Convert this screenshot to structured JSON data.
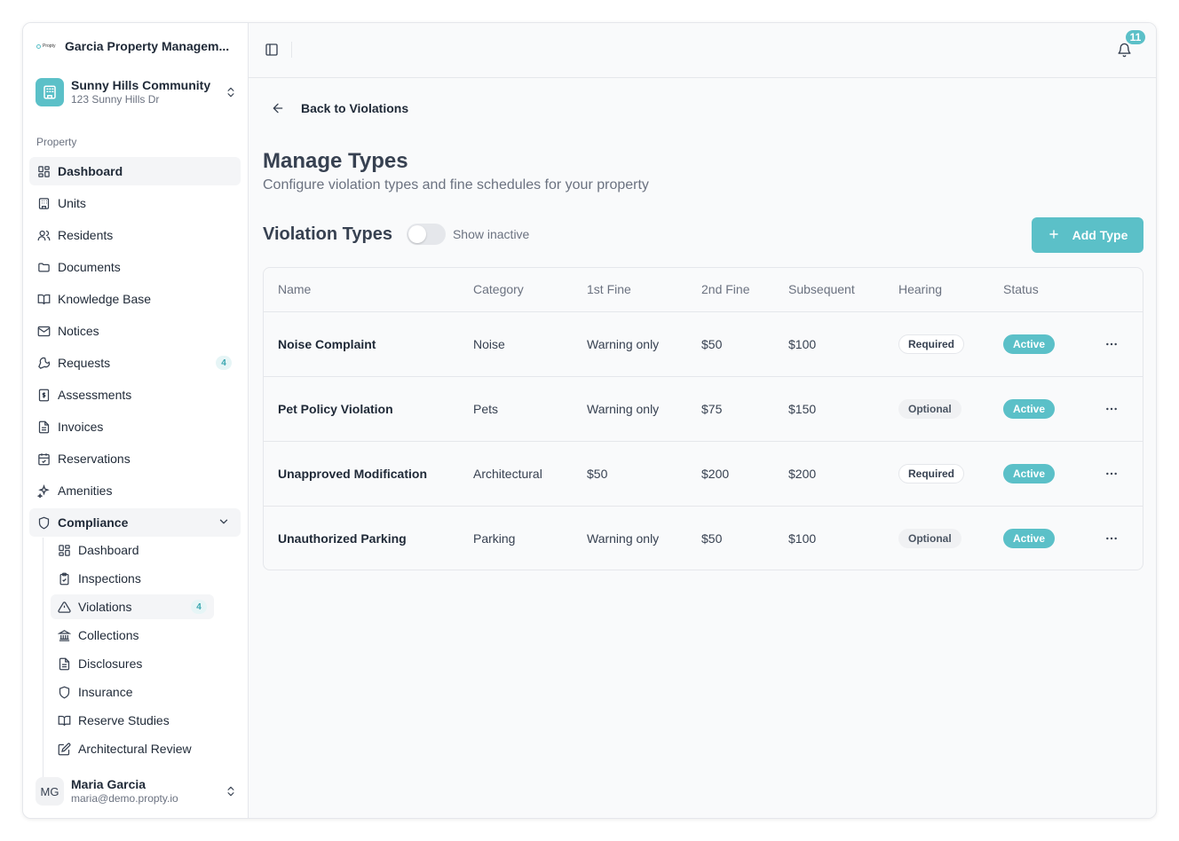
{
  "org": {
    "logo_text": "Propty",
    "name": "Garcia Property Managem..."
  },
  "community": {
    "name": "Sunny Hills Community",
    "address": "123 Sunny Hills Dr"
  },
  "sidebar": {
    "section_label": "Property",
    "items": [
      {
        "label": "Dashboard",
        "icon": "dashboard-icon"
      },
      {
        "label": "Units",
        "icon": "building-icon"
      },
      {
        "label": "Residents",
        "icon": "users-icon"
      },
      {
        "label": "Documents",
        "icon": "folder-icon"
      },
      {
        "label": "Knowledge Base",
        "icon": "book-icon"
      },
      {
        "label": "Notices",
        "icon": "mail-icon"
      },
      {
        "label": "Requests",
        "icon": "wrench-icon",
        "badge": "4"
      },
      {
        "label": "Assessments",
        "icon": "dollar-icon"
      },
      {
        "label": "Invoices",
        "icon": "file-icon"
      },
      {
        "label": "Reservations",
        "icon": "calendar-icon"
      },
      {
        "label": "Amenities",
        "icon": "sparkles-icon"
      },
      {
        "label": "Compliance",
        "icon": "shield-icon"
      }
    ],
    "compliance_items": [
      {
        "label": "Dashboard",
        "icon": "dashboard-icon"
      },
      {
        "label": "Inspections",
        "icon": "clipboard-icon"
      },
      {
        "label": "Violations",
        "icon": "warning-icon",
        "badge": "4"
      },
      {
        "label": "Collections",
        "icon": "bank-icon"
      },
      {
        "label": "Disclosures",
        "icon": "file-text-icon"
      },
      {
        "label": "Insurance",
        "icon": "shield-icon"
      },
      {
        "label": "Reserve Studies",
        "icon": "book-icon"
      },
      {
        "label": "Architectural Review",
        "icon": "edit-icon"
      }
    ]
  },
  "user": {
    "initials": "MG",
    "name": "Maria Garcia",
    "email": "maria@demo.propty.io"
  },
  "topbar": {
    "notification_count": "11"
  },
  "page": {
    "back_label": "Back to Violations",
    "title": "Manage Types",
    "subtitle": "Configure violation types and fine schedules for your property",
    "section_title": "Violation Types",
    "toggle_label": "Show inactive",
    "add_button": "Add Type"
  },
  "table": {
    "headers": [
      "Name",
      "Category",
      "1st Fine",
      "2nd Fine",
      "Subsequent",
      "Hearing",
      "Status"
    ],
    "rows": [
      {
        "name": "Noise Complaint",
        "category": "Noise",
        "fine1": "Warning only",
        "fine2": "$50",
        "subsequent": "$100",
        "hearing": "Required",
        "status": "Active"
      },
      {
        "name": "Pet Policy Violation",
        "category": "Pets",
        "fine1": "Warning only",
        "fine2": "$75",
        "subsequent": "$150",
        "hearing": "Optional",
        "status": "Active"
      },
      {
        "name": "Unapproved Modification",
        "category": "Architectural",
        "fine1": "$50",
        "fine2": "$200",
        "subsequent": "$200",
        "hearing": "Required",
        "status": "Active"
      },
      {
        "name": "Unauthorized Parking",
        "category": "Parking",
        "fine1": "Warning only",
        "fine2": "$50",
        "subsequent": "$100",
        "hearing": "Optional",
        "status": "Active"
      }
    ]
  },
  "colors": {
    "accent": "#5bc0c8",
    "text": "#1f2937",
    "muted": "#6b7280",
    "border": "#e5e7eb"
  }
}
